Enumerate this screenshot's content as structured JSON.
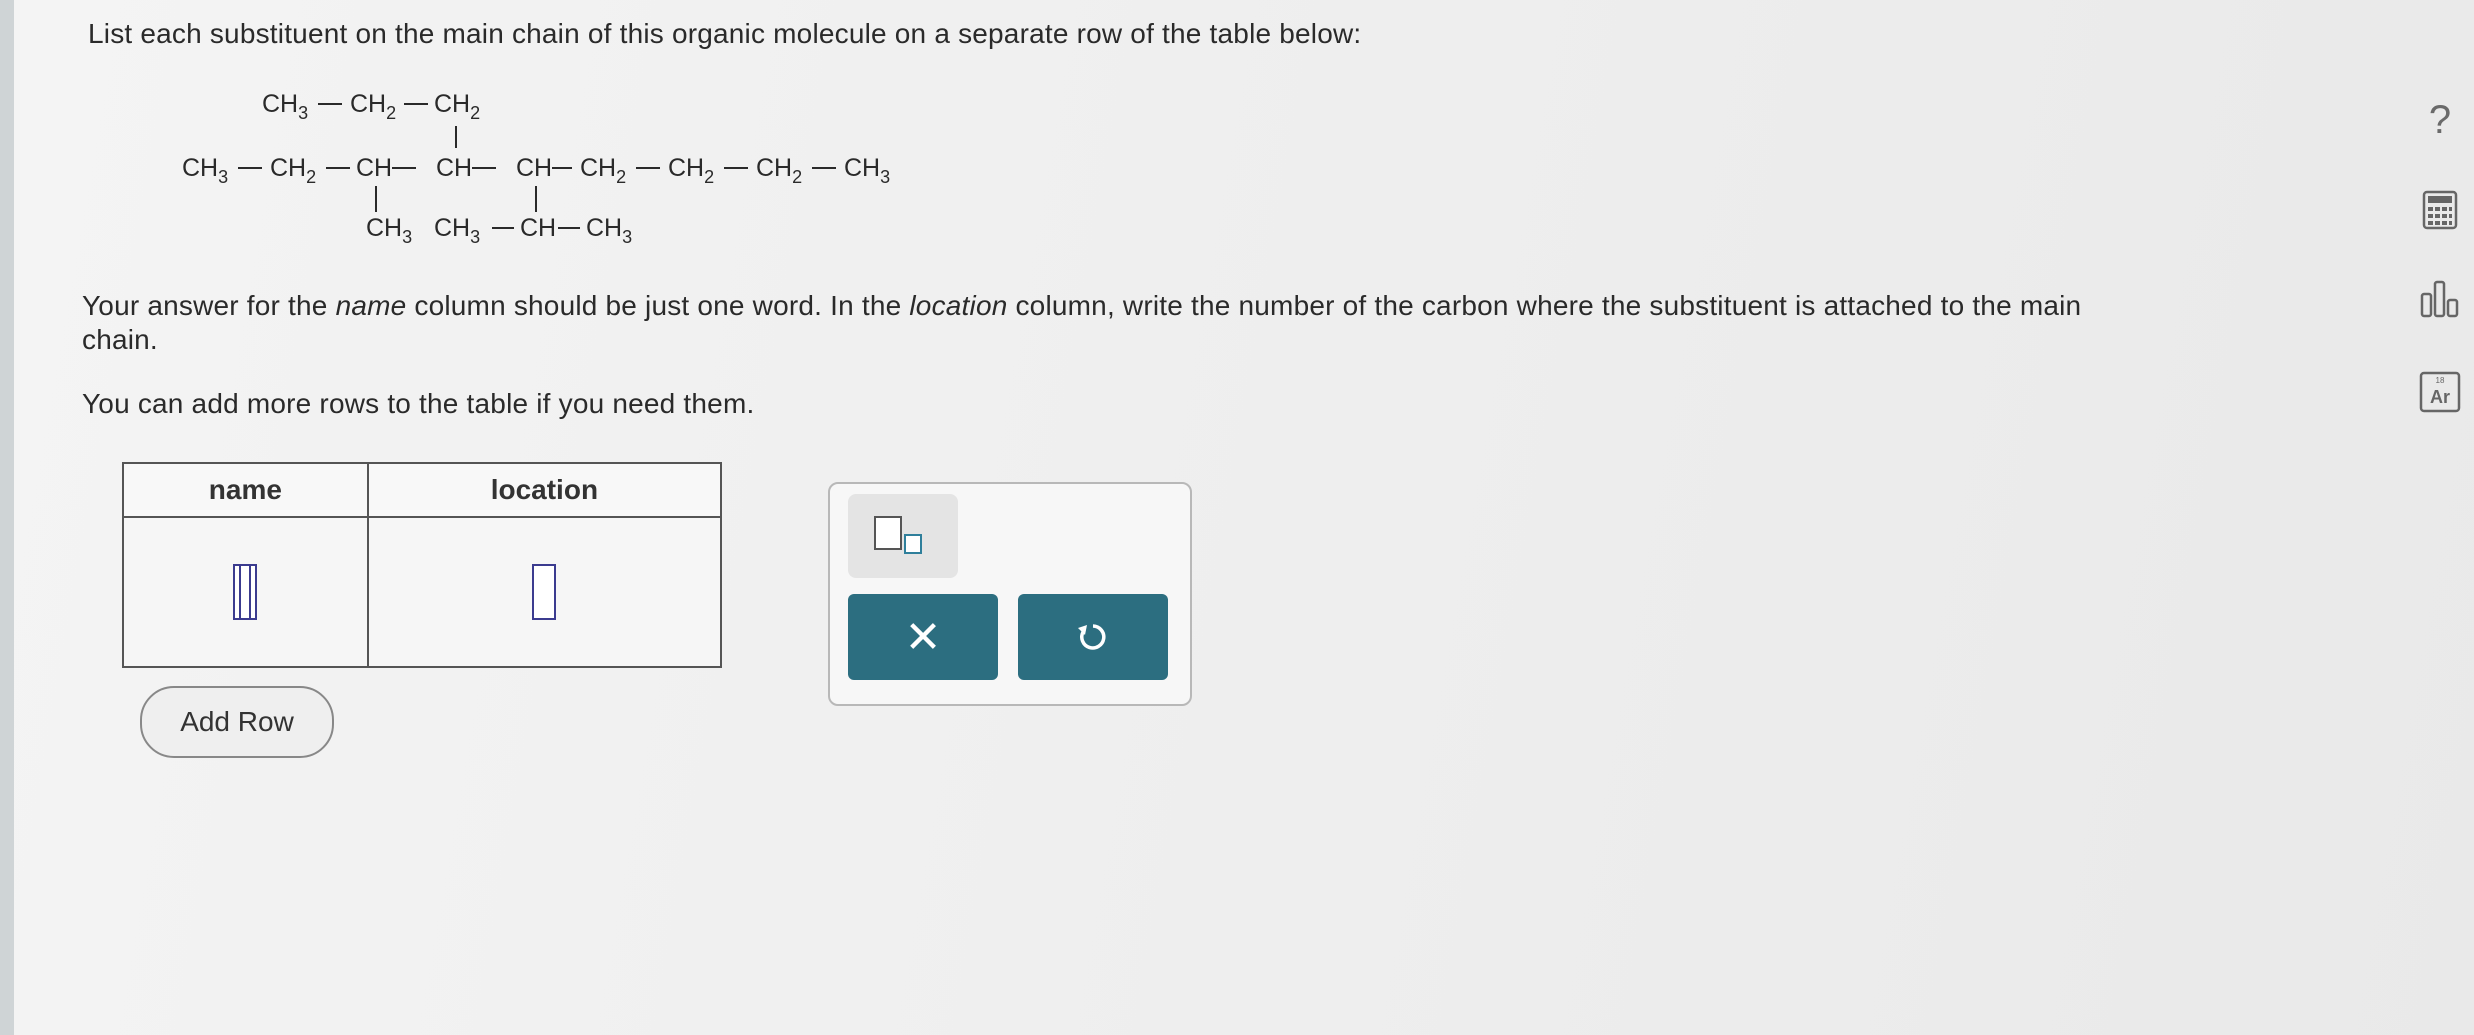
{
  "instructions": {
    "line1": "List each substituent on the main chain of this organic molecule on a separate row of the table below:",
    "line2_a": "Your answer for the ",
    "line2_name": "name",
    "line2_b": " column should be just one word. In the ",
    "line2_location": "location",
    "line2_c": " column, write the number of the carbon where the substituent is attached to the main",
    "line2_d": "chain.",
    "line3": "You can add more rows to the table if you need them."
  },
  "molecule": {
    "ch3": "CH",
    "ch2": "CH",
    "ch": "CH",
    "sub3": "3",
    "sub2": "2"
  },
  "table": {
    "headers": [
      "name",
      "location"
    ]
  },
  "add_row_label": "Add Row",
  "panel": {
    "clear_symbol": "✕"
  },
  "sidebar": {
    "help_symbol": "?",
    "periodic_label": "Ar",
    "periodic_number": "18"
  }
}
